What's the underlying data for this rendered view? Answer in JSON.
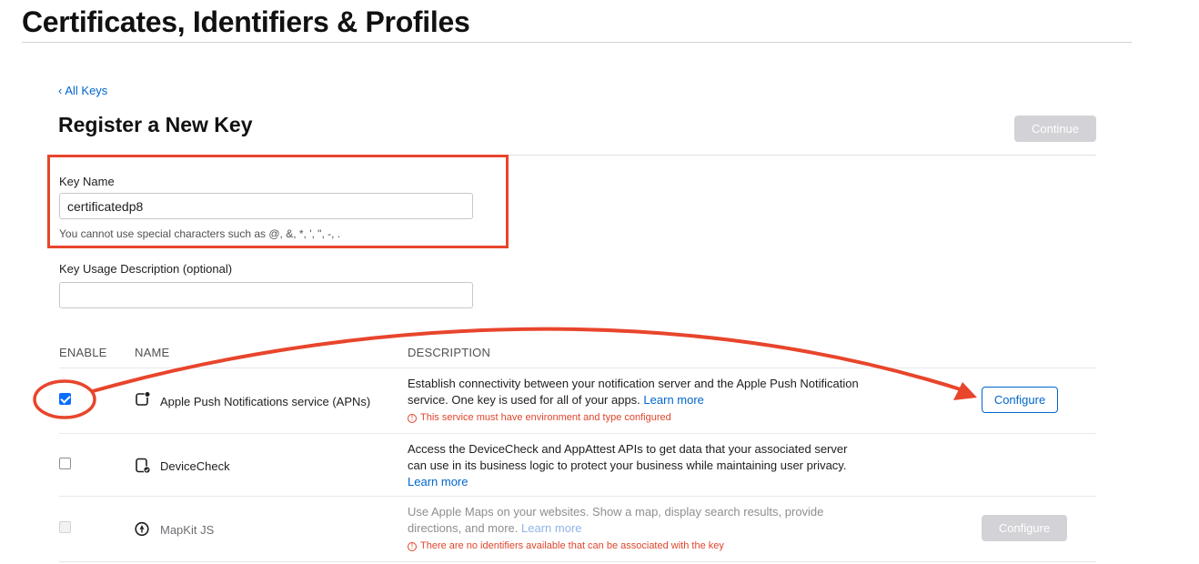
{
  "header": {
    "title": "Certificates, Identifiers & Profiles"
  },
  "nav": {
    "back_label": "All Keys"
  },
  "form": {
    "section_title": "Register a New Key",
    "continue_label": "Continue",
    "key_name_label": "Key Name",
    "key_name_value": "certificatedp8",
    "key_name_hint": "You cannot use special characters such as @, &, *, ', \", -, .",
    "usage_label": "Key Usage Description (optional)",
    "usage_value": ""
  },
  "table": {
    "headers": {
      "enable": "ENABLE",
      "name": "NAME",
      "description": "DESCRIPTION"
    },
    "rows": [
      {
        "name": "Apple Push Notifications service (APNs)",
        "description": "Establish connectivity between your notification server and the Apple Push Notification service. One key is used for all of your apps.",
        "learn_more": "Learn more",
        "warning": "This service must have environment and type configured",
        "configure_label": "Configure",
        "checked": true,
        "icon": "push-notification-icon"
      },
      {
        "name": "DeviceCheck",
        "description": "Access the DeviceCheck and AppAttest APIs to get data that your associated server can use in its business logic to protect your business while maintaining user privacy.",
        "learn_more": "Learn more",
        "checked": false,
        "icon": "device-check-icon"
      },
      {
        "name": "MapKit JS",
        "description": "Use Apple Maps on your websites. Show a map, display search results, provide directions, and more.",
        "learn_more": "Learn more",
        "warning": "There are no identifiers available that can be associated with the key",
        "configure_label": "Configure",
        "checked": false,
        "disabled": true,
        "icon": "mapkit-icon"
      }
    ]
  },
  "colors": {
    "accent": "#0066cc",
    "annotation": "#e8452c",
    "warning": "#e0452c",
    "disabled_button": "#d2d2d7"
  }
}
